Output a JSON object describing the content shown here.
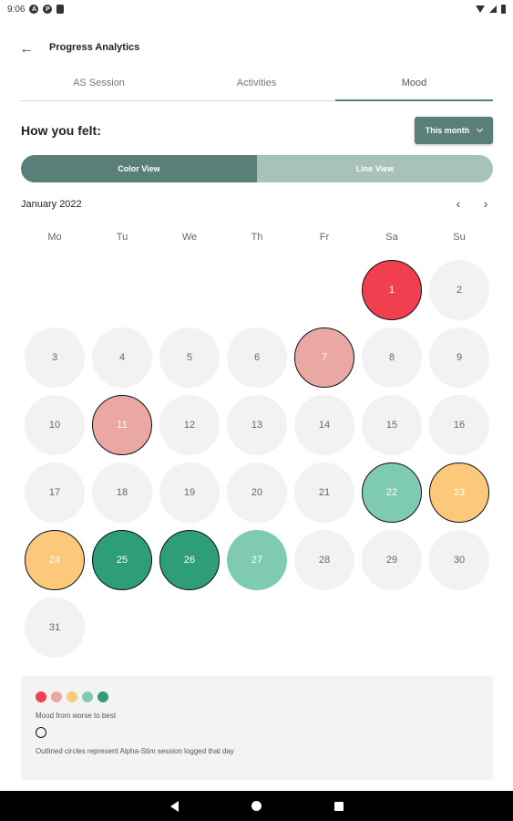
{
  "status_bar": {
    "time": "9:06",
    "icons": [
      "a-icon",
      "p-icon",
      "sim-icon",
      "wifi-icon",
      "signal-icon",
      "battery-icon"
    ]
  },
  "header": {
    "back_icon": "arrow-left-icon",
    "title": "Progress Analytics"
  },
  "tabs": [
    {
      "label": "AS Session",
      "active": false
    },
    {
      "label": "Activities",
      "active": false
    },
    {
      "label": "Mood",
      "active": true
    }
  ],
  "mood": {
    "prompt": "How you felt:",
    "period_select": {
      "value": "This month"
    },
    "views": [
      {
        "label": "Color View",
        "active": true
      },
      {
        "label": "Line View",
        "active": false
      }
    ]
  },
  "calendar": {
    "month_label": "January 2022",
    "prev_icon": "chevron-left-icon",
    "next_icon": "chevron-right-icon",
    "weekdays": [
      "Mo",
      "Tu",
      "We",
      "Th",
      "Fr",
      "Sa",
      "Su"
    ],
    "first_weekday_index": 5,
    "days": [
      {
        "day": "1",
        "mood": 1,
        "outlined": true
      },
      {
        "day": "2",
        "mood": null,
        "outlined": false
      },
      {
        "day": "3",
        "mood": null,
        "outlined": false
      },
      {
        "day": "4",
        "mood": null,
        "outlined": false
      },
      {
        "day": "5",
        "mood": null,
        "outlined": false
      },
      {
        "day": "6",
        "mood": null,
        "outlined": false
      },
      {
        "day": "7",
        "mood": 2,
        "outlined": true
      },
      {
        "day": "8",
        "mood": null,
        "outlined": false
      },
      {
        "day": "9",
        "mood": null,
        "outlined": false
      },
      {
        "day": "10",
        "mood": null,
        "outlined": false
      },
      {
        "day": "11",
        "mood": 2,
        "outlined": true
      },
      {
        "day": "12",
        "mood": null,
        "outlined": false
      },
      {
        "day": "13",
        "mood": null,
        "outlined": false
      },
      {
        "day": "14",
        "mood": null,
        "outlined": false
      },
      {
        "day": "15",
        "mood": null,
        "outlined": false
      },
      {
        "day": "16",
        "mood": null,
        "outlined": false
      },
      {
        "day": "17",
        "mood": null,
        "outlined": false
      },
      {
        "day": "18",
        "mood": null,
        "outlined": false
      },
      {
        "day": "19",
        "mood": null,
        "outlined": false
      },
      {
        "day": "20",
        "mood": null,
        "outlined": false
      },
      {
        "day": "21",
        "mood": null,
        "outlined": false
      },
      {
        "day": "22",
        "mood": 4,
        "outlined": true
      },
      {
        "day": "23",
        "mood": 3,
        "outlined": true
      },
      {
        "day": "24",
        "mood": 3,
        "outlined": true
      },
      {
        "day": "25",
        "mood": 5,
        "outlined": true
      },
      {
        "day": "26",
        "mood": 5,
        "outlined": true
      },
      {
        "day": "27",
        "mood": 4,
        "outlined": false
      },
      {
        "day": "28",
        "mood": null,
        "outlined": false
      },
      {
        "day": "29",
        "mood": null,
        "outlined": false
      },
      {
        "day": "30",
        "mood": null,
        "outlined": false
      },
      {
        "day": "31",
        "mood": null,
        "outlined": false
      }
    ]
  },
  "mood_colors": [
    "#f0404f",
    "#e9a8a3",
    "#fcc97b",
    "#7fcab2",
    "#2e9e78"
  ],
  "no_mood_color": "#f2f2f2",
  "legend": {
    "scale_text": "Mood from worse to best",
    "outline_text": "Outlined circles represent Alpha-Stim session logged that day"
  },
  "nav_bar": {
    "icons": [
      "back-triangle-icon",
      "home-circle-icon",
      "recents-square-icon"
    ]
  }
}
